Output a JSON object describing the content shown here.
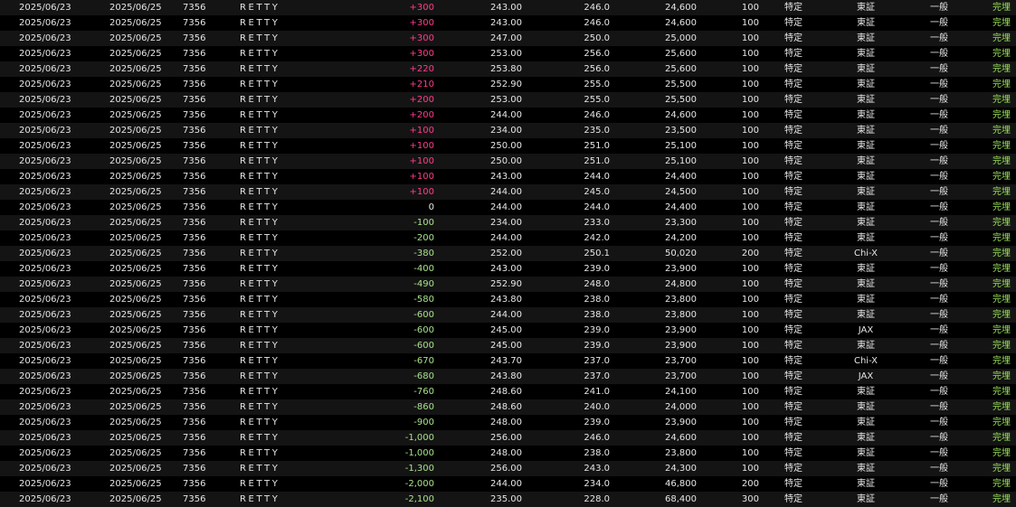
{
  "colors": {
    "background": "#000000",
    "row_alt": "#141414",
    "text": "#e6e6e6",
    "profit": "#ff3c8c",
    "loss": "#a8e28a",
    "status": "#9be35a"
  },
  "rows": [
    {
      "trade_date": "2025/06/23",
      "settle_date": "2025/06/25",
      "code": "7356",
      "name": "RETTY",
      "pl": "+300",
      "buy": "243.00",
      "sell": "246.0",
      "amount": "24,600",
      "qty": "100",
      "account": "特定",
      "market": "東証",
      "type": "一般",
      "status": "完埋"
    },
    {
      "trade_date": "2025/06/23",
      "settle_date": "2025/06/25",
      "code": "7356",
      "name": "RETTY",
      "pl": "+300",
      "buy": "243.00",
      "sell": "246.0",
      "amount": "24,600",
      "qty": "100",
      "account": "特定",
      "market": "東証",
      "type": "一般",
      "status": "完埋"
    },
    {
      "trade_date": "2025/06/23",
      "settle_date": "2025/06/25",
      "code": "7356",
      "name": "RETTY",
      "pl": "+300",
      "buy": "247.00",
      "sell": "250.0",
      "amount": "25,000",
      "qty": "100",
      "account": "特定",
      "market": "東証",
      "type": "一般",
      "status": "完埋"
    },
    {
      "trade_date": "2025/06/23",
      "settle_date": "2025/06/25",
      "code": "7356",
      "name": "RETTY",
      "pl": "+300",
      "buy": "253.00",
      "sell": "256.0",
      "amount": "25,600",
      "qty": "100",
      "account": "特定",
      "market": "東証",
      "type": "一般",
      "status": "完埋"
    },
    {
      "trade_date": "2025/06/23",
      "settle_date": "2025/06/25",
      "code": "7356",
      "name": "RETTY",
      "pl": "+220",
      "buy": "253.80",
      "sell": "256.0",
      "amount": "25,600",
      "qty": "100",
      "account": "特定",
      "market": "東証",
      "type": "一般",
      "status": "完埋"
    },
    {
      "trade_date": "2025/06/23",
      "settle_date": "2025/06/25",
      "code": "7356",
      "name": "RETTY",
      "pl": "+210",
      "buy": "252.90",
      "sell": "255.0",
      "amount": "25,500",
      "qty": "100",
      "account": "特定",
      "market": "東証",
      "type": "一般",
      "status": "完埋"
    },
    {
      "trade_date": "2025/06/23",
      "settle_date": "2025/06/25",
      "code": "7356",
      "name": "RETTY",
      "pl": "+200",
      "buy": "253.00",
      "sell": "255.0",
      "amount": "25,500",
      "qty": "100",
      "account": "特定",
      "market": "東証",
      "type": "一般",
      "status": "完埋"
    },
    {
      "trade_date": "2025/06/23",
      "settle_date": "2025/06/25",
      "code": "7356",
      "name": "RETTY",
      "pl": "+200",
      "buy": "244.00",
      "sell": "246.0",
      "amount": "24,600",
      "qty": "100",
      "account": "特定",
      "market": "東証",
      "type": "一般",
      "status": "完埋"
    },
    {
      "trade_date": "2025/06/23",
      "settle_date": "2025/06/25",
      "code": "7356",
      "name": "RETTY",
      "pl": "+100",
      "buy": "234.00",
      "sell": "235.0",
      "amount": "23,500",
      "qty": "100",
      "account": "特定",
      "market": "東証",
      "type": "一般",
      "status": "完埋"
    },
    {
      "trade_date": "2025/06/23",
      "settle_date": "2025/06/25",
      "code": "7356",
      "name": "RETTY",
      "pl": "+100",
      "buy": "250.00",
      "sell": "251.0",
      "amount": "25,100",
      "qty": "100",
      "account": "特定",
      "market": "東証",
      "type": "一般",
      "status": "完埋"
    },
    {
      "trade_date": "2025/06/23",
      "settle_date": "2025/06/25",
      "code": "7356",
      "name": "RETTY",
      "pl": "+100",
      "buy": "250.00",
      "sell": "251.0",
      "amount": "25,100",
      "qty": "100",
      "account": "特定",
      "market": "東証",
      "type": "一般",
      "status": "完埋"
    },
    {
      "trade_date": "2025/06/23",
      "settle_date": "2025/06/25",
      "code": "7356",
      "name": "RETTY",
      "pl": "+100",
      "buy": "243.00",
      "sell": "244.0",
      "amount": "24,400",
      "qty": "100",
      "account": "特定",
      "market": "東証",
      "type": "一般",
      "status": "完埋"
    },
    {
      "trade_date": "2025/06/23",
      "settle_date": "2025/06/25",
      "code": "7356",
      "name": "RETTY",
      "pl": "+100",
      "buy": "244.00",
      "sell": "245.0",
      "amount": "24,500",
      "qty": "100",
      "account": "特定",
      "market": "東証",
      "type": "一般",
      "status": "完埋"
    },
    {
      "trade_date": "2025/06/23",
      "settle_date": "2025/06/25",
      "code": "7356",
      "name": "RETTY",
      "pl": "0",
      "buy": "244.00",
      "sell": "244.0",
      "amount": "24,400",
      "qty": "100",
      "account": "特定",
      "market": "東証",
      "type": "一般",
      "status": "完埋"
    },
    {
      "trade_date": "2025/06/23",
      "settle_date": "2025/06/25",
      "code": "7356",
      "name": "RETTY",
      "pl": "-100",
      "buy": "234.00",
      "sell": "233.0",
      "amount": "23,300",
      "qty": "100",
      "account": "特定",
      "market": "東証",
      "type": "一般",
      "status": "完埋"
    },
    {
      "trade_date": "2025/06/23",
      "settle_date": "2025/06/25",
      "code": "7356",
      "name": "RETTY",
      "pl": "-200",
      "buy": "244.00",
      "sell": "242.0",
      "amount": "24,200",
      "qty": "100",
      "account": "特定",
      "market": "東証",
      "type": "一般",
      "status": "完埋"
    },
    {
      "trade_date": "2025/06/23",
      "settle_date": "2025/06/25",
      "code": "7356",
      "name": "RETTY",
      "pl": "-380",
      "buy": "252.00",
      "sell": "250.1",
      "amount": "50,020",
      "qty": "200",
      "account": "特定",
      "market": "Chi-X",
      "type": "一般",
      "status": "完埋"
    },
    {
      "trade_date": "2025/06/23",
      "settle_date": "2025/06/25",
      "code": "7356",
      "name": "RETTY",
      "pl": "-400",
      "buy": "243.00",
      "sell": "239.0",
      "amount": "23,900",
      "qty": "100",
      "account": "特定",
      "market": "東証",
      "type": "一般",
      "status": "完埋"
    },
    {
      "trade_date": "2025/06/23",
      "settle_date": "2025/06/25",
      "code": "7356",
      "name": "RETTY",
      "pl": "-490",
      "buy": "252.90",
      "sell": "248.0",
      "amount": "24,800",
      "qty": "100",
      "account": "特定",
      "market": "東証",
      "type": "一般",
      "status": "完埋"
    },
    {
      "trade_date": "2025/06/23",
      "settle_date": "2025/06/25",
      "code": "7356",
      "name": "RETTY",
      "pl": "-580",
      "buy": "243.80",
      "sell": "238.0",
      "amount": "23,800",
      "qty": "100",
      "account": "特定",
      "market": "東証",
      "type": "一般",
      "status": "完埋"
    },
    {
      "trade_date": "2025/06/23",
      "settle_date": "2025/06/25",
      "code": "7356",
      "name": "RETTY",
      "pl": "-600",
      "buy": "244.00",
      "sell": "238.0",
      "amount": "23,800",
      "qty": "100",
      "account": "特定",
      "market": "東証",
      "type": "一般",
      "status": "完埋"
    },
    {
      "trade_date": "2025/06/23",
      "settle_date": "2025/06/25",
      "code": "7356",
      "name": "RETTY",
      "pl": "-600",
      "buy": "245.00",
      "sell": "239.0",
      "amount": "23,900",
      "qty": "100",
      "account": "特定",
      "market": "JAX",
      "type": "一般",
      "status": "完埋"
    },
    {
      "trade_date": "2025/06/23",
      "settle_date": "2025/06/25",
      "code": "7356",
      "name": "RETTY",
      "pl": "-600",
      "buy": "245.00",
      "sell": "239.0",
      "amount": "23,900",
      "qty": "100",
      "account": "特定",
      "market": "東証",
      "type": "一般",
      "status": "完埋"
    },
    {
      "trade_date": "2025/06/23",
      "settle_date": "2025/06/25",
      "code": "7356",
      "name": "RETTY",
      "pl": "-670",
      "buy": "243.70",
      "sell": "237.0",
      "amount": "23,700",
      "qty": "100",
      "account": "特定",
      "market": "Chi-X",
      "type": "一般",
      "status": "完埋"
    },
    {
      "trade_date": "2025/06/23",
      "settle_date": "2025/06/25",
      "code": "7356",
      "name": "RETTY",
      "pl": "-680",
      "buy": "243.80",
      "sell": "237.0",
      "amount": "23,700",
      "qty": "100",
      "account": "特定",
      "market": "JAX",
      "type": "一般",
      "status": "完埋"
    },
    {
      "trade_date": "2025/06/23",
      "settle_date": "2025/06/25",
      "code": "7356",
      "name": "RETTY",
      "pl": "-760",
      "buy": "248.60",
      "sell": "241.0",
      "amount": "24,100",
      "qty": "100",
      "account": "特定",
      "market": "東証",
      "type": "一般",
      "status": "完埋"
    },
    {
      "trade_date": "2025/06/23",
      "settle_date": "2025/06/25",
      "code": "7356",
      "name": "RETTY",
      "pl": "-860",
      "buy": "248.60",
      "sell": "240.0",
      "amount": "24,000",
      "qty": "100",
      "account": "特定",
      "market": "東証",
      "type": "一般",
      "status": "完埋"
    },
    {
      "trade_date": "2025/06/23",
      "settle_date": "2025/06/25",
      "code": "7356",
      "name": "RETTY",
      "pl": "-900",
      "buy": "248.00",
      "sell": "239.0",
      "amount": "23,900",
      "qty": "100",
      "account": "特定",
      "market": "東証",
      "type": "一般",
      "status": "完埋"
    },
    {
      "trade_date": "2025/06/23",
      "settle_date": "2025/06/25",
      "code": "7356",
      "name": "RETTY",
      "pl": "-1,000",
      "buy": "256.00",
      "sell": "246.0",
      "amount": "24,600",
      "qty": "100",
      "account": "特定",
      "market": "東証",
      "type": "一般",
      "status": "完埋"
    },
    {
      "trade_date": "2025/06/23",
      "settle_date": "2025/06/25",
      "code": "7356",
      "name": "RETTY",
      "pl": "-1,000",
      "buy": "248.00",
      "sell": "238.0",
      "amount": "23,800",
      "qty": "100",
      "account": "特定",
      "market": "東証",
      "type": "一般",
      "status": "完埋"
    },
    {
      "trade_date": "2025/06/23",
      "settle_date": "2025/06/25",
      "code": "7356",
      "name": "RETTY",
      "pl": "-1,300",
      "buy": "256.00",
      "sell": "243.0",
      "amount": "24,300",
      "qty": "100",
      "account": "特定",
      "market": "東証",
      "type": "一般",
      "status": "完埋"
    },
    {
      "trade_date": "2025/06/23",
      "settle_date": "2025/06/25",
      "code": "7356",
      "name": "RETTY",
      "pl": "-2,000",
      "buy": "244.00",
      "sell": "234.0",
      "amount": "46,800",
      "qty": "200",
      "account": "特定",
      "market": "東証",
      "type": "一般",
      "status": "完埋"
    },
    {
      "trade_date": "2025/06/23",
      "settle_date": "2025/06/25",
      "code": "7356",
      "name": "RETTY",
      "pl": "-2,100",
      "buy": "235.00",
      "sell": "228.0",
      "amount": "68,400",
      "qty": "300",
      "account": "特定",
      "market": "東証",
      "type": "一般",
      "status": "完埋"
    }
  ]
}
